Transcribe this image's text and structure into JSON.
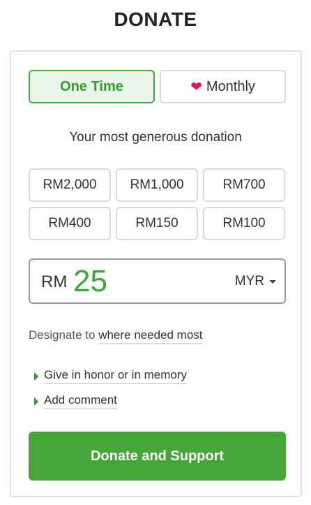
{
  "page_title": "DONATE",
  "frequency": {
    "one_time_label": "One Time",
    "monthly_label": "Monthly",
    "selected": "One Time"
  },
  "subtitle": "Your most generous donation",
  "amount_options": [
    "RM2,000",
    "RM1,000",
    "RM700",
    "RM400",
    "RM150",
    "RM100"
  ],
  "custom_amount": {
    "prefix": "RM",
    "value": "25",
    "currency": "MYR"
  },
  "designation": {
    "label": "Designate to",
    "value": "where needed most"
  },
  "options": {
    "honor_label": "Give in honor or in memory",
    "comment_label": "Add comment"
  },
  "submit_label": "Donate and Support",
  "colors": {
    "accent": "#43a637",
    "selected_bg": "#e8f5e8",
    "heart": "#e8184a"
  }
}
